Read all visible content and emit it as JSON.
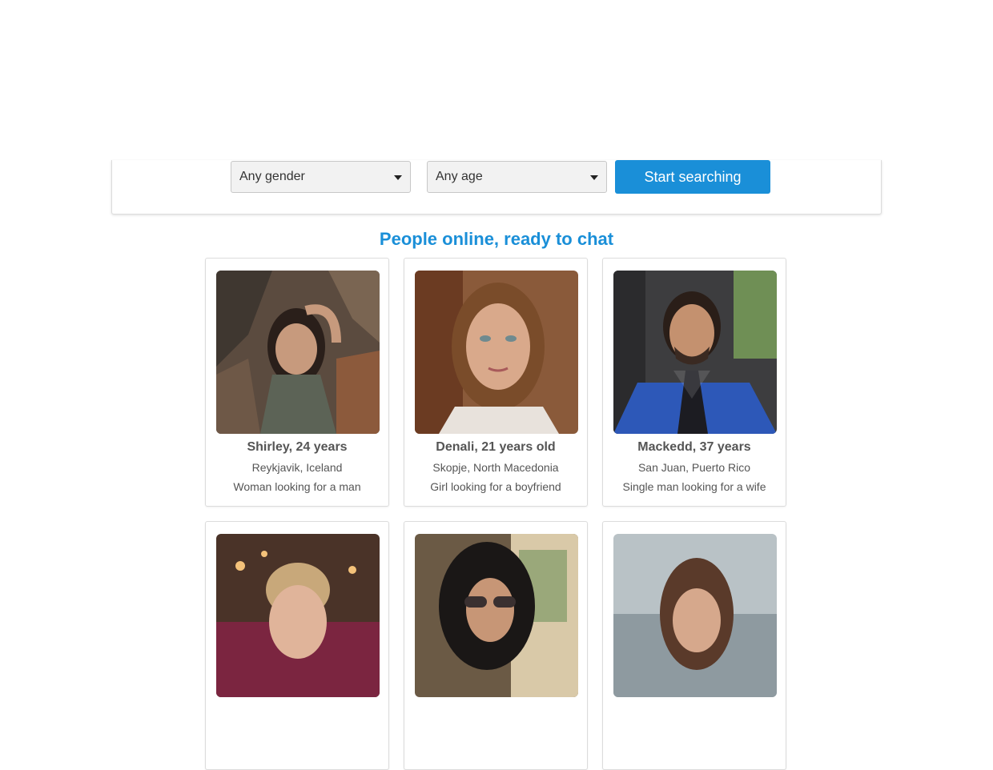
{
  "search": {
    "gender_selected": "Any gender",
    "age_selected": "Any age",
    "button_label": "Start searching"
  },
  "section": {
    "title": "People online, ready to chat"
  },
  "colors": {
    "accent": "#1a8fd8"
  },
  "profiles": [
    {
      "name": "Shirley, 24 years",
      "location": "Reykjavik, Iceland",
      "description": "Woman looking for a man"
    },
    {
      "name": "Denali, 21 years old",
      "location": "Skopje, North Macedonia",
      "description": "Girl looking for a boyfriend"
    },
    {
      "name": "Mackedd, 37 years",
      "location": "San Juan, Puerto Rico",
      "description": "Single man looking for a wife"
    },
    {
      "name": "",
      "location": "",
      "description": ""
    },
    {
      "name": "",
      "location": "",
      "description": ""
    },
    {
      "name": "",
      "location": "",
      "description": ""
    }
  ]
}
